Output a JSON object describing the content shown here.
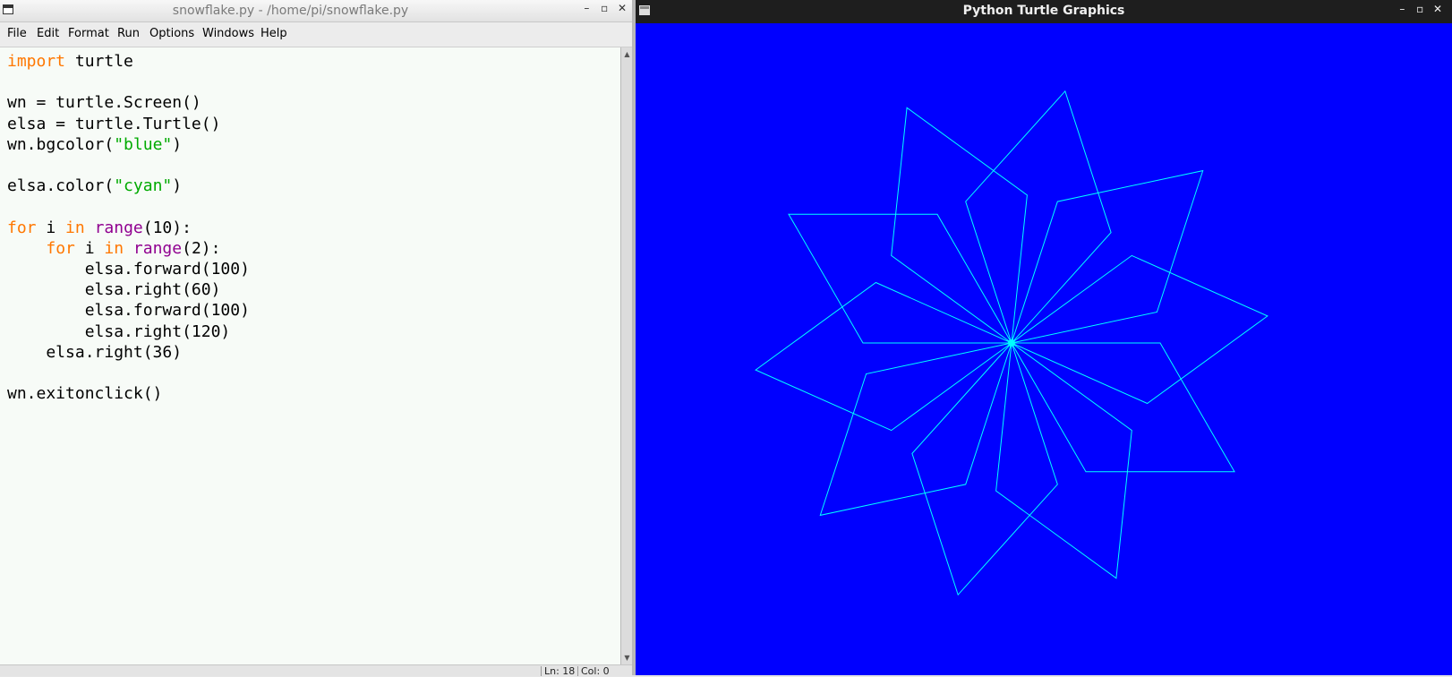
{
  "editor": {
    "title": "snowflake.py - /home/pi/snowflake.py",
    "controls": {
      "minimize": "–",
      "maximize": "▫",
      "close": "✕"
    },
    "menu": [
      "File",
      "Edit",
      "Format",
      "Run",
      "Options",
      "Windows",
      "Help"
    ],
    "code": [
      [
        {
          "t": "import",
          "c": "kw"
        },
        {
          "t": " turtle"
        }
      ],
      [],
      [
        {
          "t": "wn = turtle.Screen()"
        }
      ],
      [
        {
          "t": "elsa = turtle.Turtle()"
        }
      ],
      [
        {
          "t": "wn.bgcolor("
        },
        {
          "t": "\"blue\"",
          "c": "str"
        },
        {
          "t": ")"
        }
      ],
      [],
      [
        {
          "t": "elsa.color("
        },
        {
          "t": "\"cyan\"",
          "c": "str"
        },
        {
          "t": ")"
        }
      ],
      [],
      [
        {
          "t": "for",
          "c": "kw"
        },
        {
          "t": " i "
        },
        {
          "t": "in",
          "c": "kw"
        },
        {
          "t": " "
        },
        {
          "t": "range",
          "c": "bi"
        },
        {
          "t": "(10):"
        }
      ],
      [
        {
          "t": "    "
        },
        {
          "t": "for",
          "c": "kw"
        },
        {
          "t": " i "
        },
        {
          "t": "in",
          "c": "kw"
        },
        {
          "t": " "
        },
        {
          "t": "range",
          "c": "bi"
        },
        {
          "t": "(2):"
        }
      ],
      [
        {
          "t": "        elsa.forward(100)"
        }
      ],
      [
        {
          "t": "        elsa.right(60)"
        }
      ],
      [
        {
          "t": "        elsa.forward(100)"
        }
      ],
      [
        {
          "t": "        elsa.right(120)"
        }
      ],
      [
        {
          "t": "    elsa.right(36)"
        }
      ],
      [],
      [
        {
          "t": "wn.exitonclick()"
        }
      ]
    ],
    "status": {
      "line": "Ln: 18",
      "col": "Col: 0"
    }
  },
  "turtle_window": {
    "title": "Python Turtle Graphics",
    "controls": {
      "minimize": "–",
      "maximize": "▫",
      "close": "✕"
    },
    "background_color": "#0000ff",
    "pen_color": "#00ffff",
    "program": {
      "outer_repeats": 10,
      "inner_repeats": 2,
      "forward": 100,
      "turn_a": 60,
      "turn_b": 120,
      "outer_turn": 36
    }
  },
  "colors": {
    "keyword": "#ff7700",
    "builtin": "#900090",
    "string": "#00aa00"
  }
}
